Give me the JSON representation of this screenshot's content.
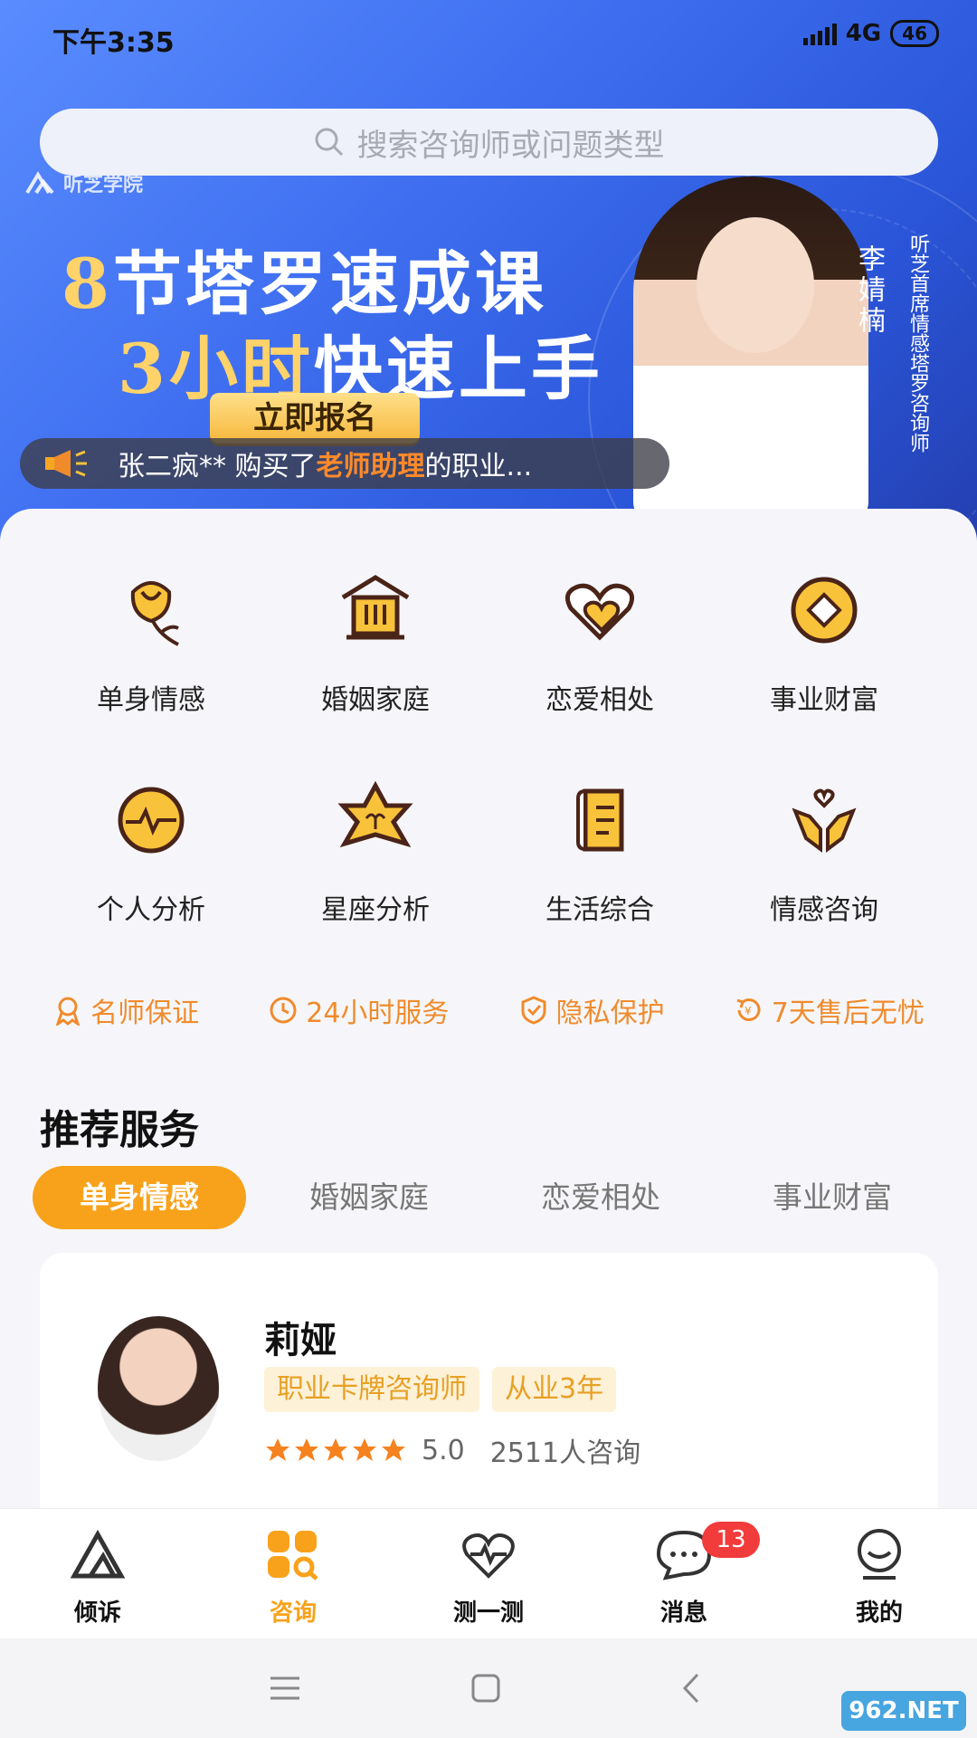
{
  "status_bar": {
    "time": "下午3:35",
    "network": "4G",
    "battery": "46"
  },
  "search": {
    "placeholder": "搜索咨询师或问题类型"
  },
  "banner": {
    "brand": "听芝学院",
    "line1_num": "8",
    "line1_text": "节塔罗速成课",
    "line2_num": "3",
    "line2_mid": "小时",
    "line2_text": "快速上手",
    "cta": "立即报名",
    "teacher_name": "李婧楠",
    "teacher_title": "听芝首席情感塔罗咨询师"
  },
  "ticker": {
    "prefix": "张二疯** 购买了",
    "highlight": "老师助理",
    "suffix": "的职业..."
  },
  "categories": [
    {
      "label": "单身情感",
      "icon": "rose-icon"
    },
    {
      "label": "婚姻家庭",
      "icon": "house-icon"
    },
    {
      "label": "恋爱相处",
      "icon": "hearts-icon"
    },
    {
      "label": "事业财富",
      "icon": "coin-icon"
    },
    {
      "label": "个人分析",
      "icon": "pulse-icon"
    },
    {
      "label": "星座分析",
      "icon": "star-sign-icon"
    },
    {
      "label": "生活综合",
      "icon": "scroll-icon"
    },
    {
      "label": "情感咨询",
      "icon": "hands-heart-icon"
    }
  ],
  "guarantees": [
    {
      "label": "名师保证",
      "icon": "medal-icon"
    },
    {
      "label": "24小时服务",
      "icon": "clock-icon"
    },
    {
      "label": "隐私保护",
      "icon": "shield-icon"
    },
    {
      "label": "7天售后无忧",
      "icon": "refund-icon"
    }
  ],
  "recommend": {
    "title": "推荐服务",
    "tabs": [
      "单身情感",
      "婚姻家庭",
      "恋爱相处",
      "事业财富"
    ],
    "active_tab": 0
  },
  "counselor": {
    "name": "莉娅",
    "tags": [
      "职业卡牌咨询师",
      "从业3年"
    ],
    "stars": 5,
    "rating": "5.0",
    "consults": "2511人咨询"
  },
  "bottom_nav": [
    {
      "label": "倾诉",
      "icon": "confide-icon"
    },
    {
      "label": "咨询",
      "icon": "consult-icon",
      "active": true
    },
    {
      "label": "测一测",
      "icon": "heartbeat-icon"
    },
    {
      "label": "消息",
      "icon": "message-icon",
      "badge": "13"
    },
    {
      "label": "我的",
      "icon": "profile-icon"
    }
  ],
  "watermark": "962.NET",
  "colors": {
    "accent": "#f8a21b",
    "guarantee": "#f08b2c",
    "banner": "#3f6ff0",
    "badge": "#f23b3b"
  }
}
